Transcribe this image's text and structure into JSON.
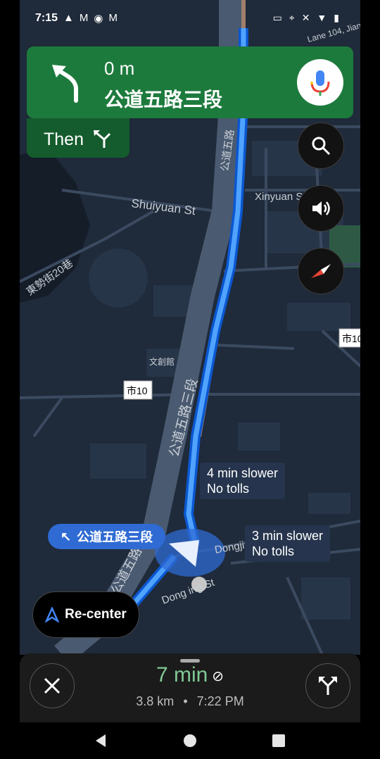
{
  "status_bar": {
    "time": "7:15",
    "icons_left": [
      "navigation-icon",
      "gmail-icon",
      "chrome-icon",
      "gmail-icon"
    ],
    "icons_right": [
      "cast-icon",
      "location-icon",
      "mute-icon",
      "wifi-icon",
      "battery-icon"
    ]
  },
  "guidance": {
    "distance": "0 m",
    "street": "公道五路三段",
    "turn": "turn-left-icon",
    "then_label": "Then",
    "then_turn": "keep-left-icon"
  },
  "map": {
    "labels": {
      "shuiyuan": "Shuiyuan St",
      "xinyuan": "Xinyuan S",
      "dongshi": "東勢街20巷",
      "wenchuang": "文創館",
      "shi10_a": "市10",
      "shi10_b": "市10",
      "road_upper": "公道五路",
      "road_middle": "公道五路三段",
      "road_lower": "公道五路三段",
      "dongjin": "Dongjin R",
      "dongjin_st": "Dong  ing St",
      "top_right": "Lane 104, Jian"
    },
    "alt_routes": [
      {
        "line1": "4 min slower",
        "line2": "No tolls"
      },
      {
        "line1": "3 min slower",
        "line2": "No tolls"
      }
    ],
    "current_street": "公道五路三段",
    "route_color": "#1a73e8"
  },
  "buttons": {
    "recenter": "Re-center",
    "search": "search-icon",
    "sound": "volume-icon",
    "compass": "compass-icon",
    "mic": "mic-icon",
    "close": "close-icon",
    "alternate_routes": "alt-routes-icon"
  },
  "trip": {
    "eta_time": "7 min",
    "distance": "3.8 km",
    "separator": "•",
    "arrival": "7:22 PM"
  },
  "colors": {
    "guidance_green": "#1d7a3d",
    "then_green": "#145c2d",
    "eta_green": "#81c995",
    "map_bg": "#1f2a3a"
  }
}
